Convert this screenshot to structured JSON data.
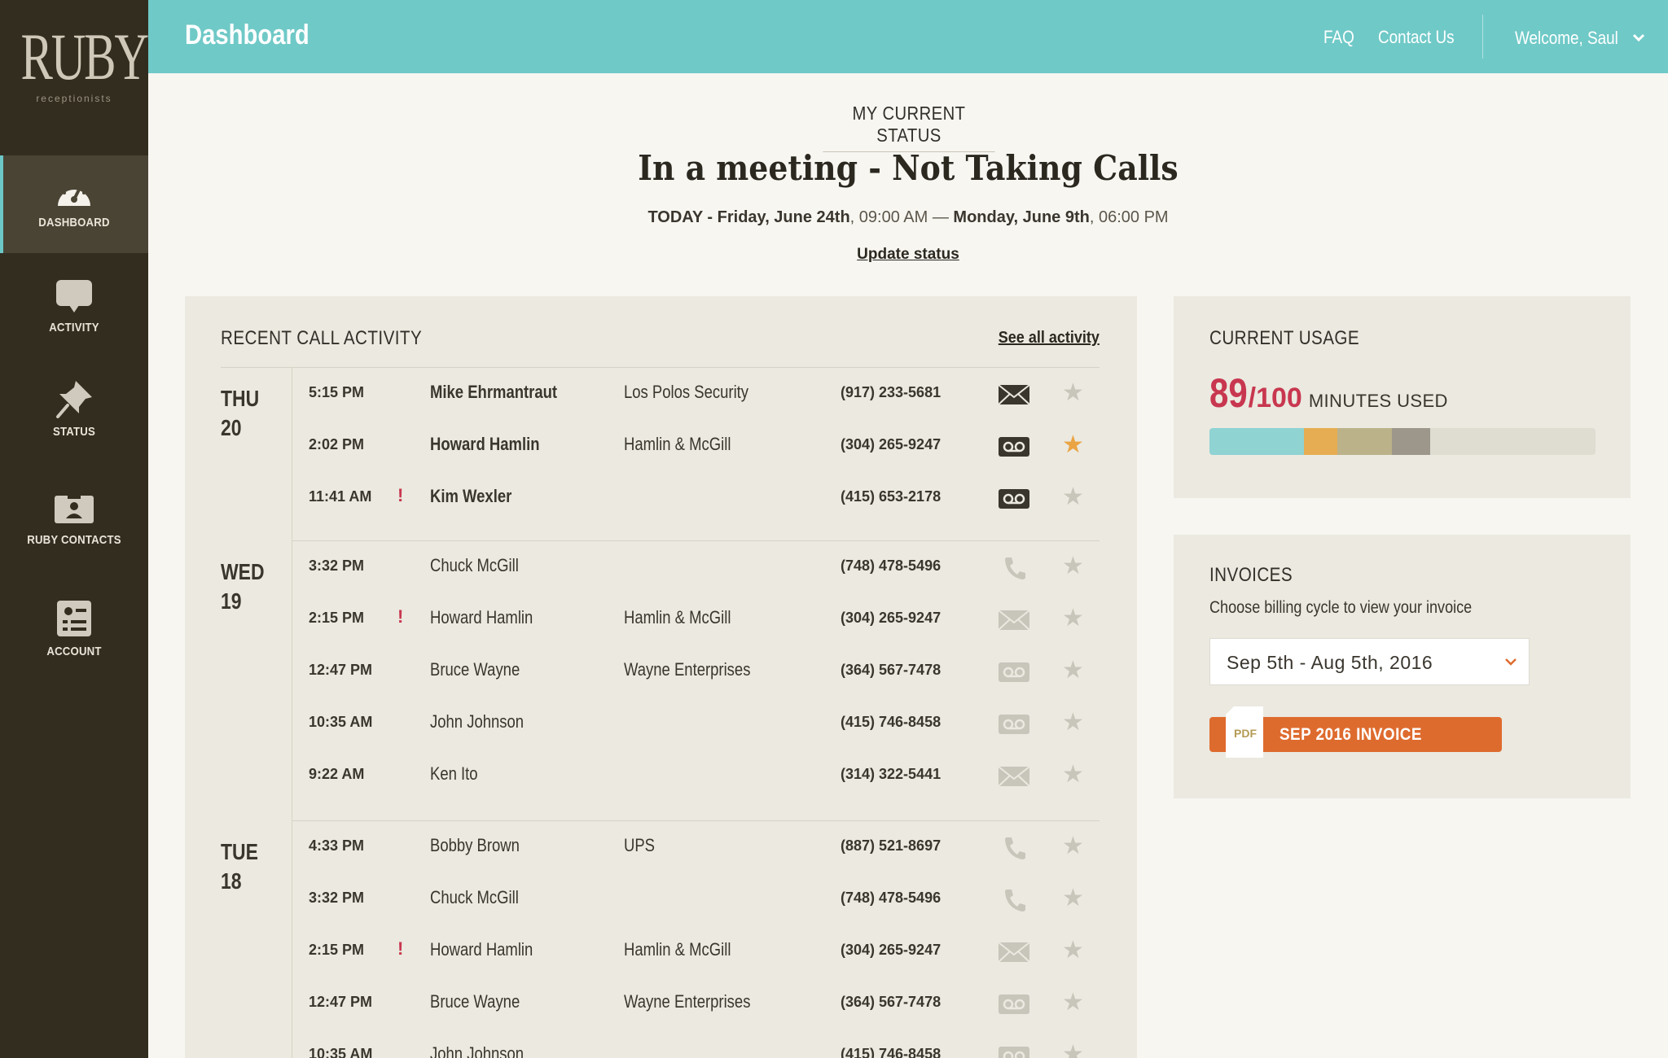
{
  "brand": {
    "logo_text": "RUBY",
    "logo_sub": "receptionists"
  },
  "nav": [
    {
      "label": "DASHBOARD",
      "icon": "speedometer-icon",
      "active": true
    },
    {
      "label": "ACTIVITY",
      "icon": "speech-bubble-icon",
      "active": false
    },
    {
      "label": "STATUS",
      "icon": "pushpin-icon",
      "active": false
    },
    {
      "label": "RUBY CONTACTS",
      "icon": "contact-card-icon",
      "active": false
    },
    {
      "label": "ACCOUNT",
      "icon": "account-book-icon",
      "active": false
    }
  ],
  "header": {
    "title": "Dashboard",
    "faq": "FAQ",
    "contact": "Contact Us",
    "welcome": "Welcome, Saul"
  },
  "status": {
    "label": "MY CURRENT STATUS",
    "text": "In a meeting - Not Taking Calls",
    "start_day": "TODAY - Friday, June 24th",
    "start_time": ", 09:00 AM",
    "sep": " — ",
    "end_day": "Monday, June 9th",
    "end_time": ", 06:00 PM",
    "update_link": "Update status"
  },
  "activity": {
    "title": "RECENT CALL ACTIVITY",
    "see_all": "See all activity",
    "days": [
      {
        "dow": "THU",
        "date": "20",
        "calls": [
          {
            "time": "5:15 PM",
            "urgent": false,
            "name": "Mike Ehrmantraut",
            "company": "Los Polos Security",
            "phone": "(917) 233-5681",
            "type": "message",
            "starred": false,
            "unread": true
          },
          {
            "time": "2:02 PM",
            "urgent": false,
            "name": "Howard Hamlin",
            "company": "Hamlin & McGill",
            "phone": "(304) 265-9247",
            "type": "voicemail",
            "starred": true,
            "unread": true
          },
          {
            "time": "11:41 AM",
            "urgent": true,
            "name": "Kim Wexler",
            "company": "",
            "phone": "(415) 653-2178",
            "type": "voicemail",
            "starred": false,
            "unread": true
          }
        ]
      },
      {
        "dow": "WED",
        "date": "19",
        "calls": [
          {
            "time": "3:32 PM",
            "urgent": false,
            "name": "Chuck McGill",
            "company": "",
            "phone": "(748) 478-5496",
            "type": "call",
            "starred": false,
            "unread": false
          },
          {
            "time": "2:15 PM",
            "urgent": true,
            "name": "Howard Hamlin",
            "company": "Hamlin & McGill",
            "phone": "(304) 265-9247",
            "type": "message",
            "starred": false,
            "unread": false
          },
          {
            "time": "12:47 PM",
            "urgent": false,
            "name": "Bruce Wayne",
            "company": "Wayne Enterprises",
            "phone": "(364) 567-7478",
            "type": "voicemail",
            "starred": false,
            "unread": false
          },
          {
            "time": "10:35 AM",
            "urgent": false,
            "name": "John Johnson",
            "company": "",
            "phone": "(415) 746-8458",
            "type": "voicemail",
            "starred": false,
            "unread": false
          },
          {
            "time": "9:22 AM",
            "urgent": false,
            "name": "Ken Ito",
            "company": "",
            "phone": "(314) 322-5441",
            "type": "message",
            "starred": false,
            "unread": false
          }
        ]
      },
      {
        "dow": "TUE",
        "date": "18",
        "calls": [
          {
            "time": "4:33 PM",
            "urgent": false,
            "name": "Bobby Brown",
            "company": "UPS",
            "phone": "(887) 521-8697",
            "type": "call",
            "starred": false,
            "unread": false
          },
          {
            "time": "3:32 PM",
            "urgent": false,
            "name": "Chuck McGill",
            "company": "",
            "phone": "(748) 478-5496",
            "type": "call",
            "starred": false,
            "unread": false
          },
          {
            "time": "2:15 PM",
            "urgent": true,
            "name": "Howard Hamlin",
            "company": "Hamlin & McGill",
            "phone": "(304) 265-9247",
            "type": "message",
            "starred": false,
            "unread": false
          },
          {
            "time": "12:47 PM",
            "urgent": false,
            "name": "Bruce Wayne",
            "company": "Wayne Enterprises",
            "phone": "(364) 567-7478",
            "type": "voicemail",
            "starred": false,
            "unread": false
          },
          {
            "time": "10:35 AM",
            "urgent": false,
            "name": "John Johnson",
            "company": "",
            "phone": "(415) 746-8458",
            "type": "voicemail",
            "starred": false,
            "unread": false
          }
        ]
      }
    ]
  },
  "usage": {
    "title": "CURRENT USAGE",
    "used": "89",
    "total": "/100",
    "label": "MINUTES USED",
    "segments": [
      {
        "fraction": 0.245,
        "color": "#8fd3d3"
      },
      {
        "fraction": 0.087,
        "color": "#e6ad52"
      },
      {
        "fraction": 0.14,
        "color": "#bbb28a"
      },
      {
        "fraction": 0.1,
        "color": "#9d978b"
      }
    ]
  },
  "invoices": {
    "title": "INVOICES",
    "help": "Choose billing cycle to view your invoice",
    "selected_cycle": "Sep 5th - Aug 5th, 2016",
    "pdf_badge": "PDF",
    "button": "SEP 2016 INVOICE"
  },
  "colors": {
    "accent": "#6fc9c7",
    "sidebar": "#332d1f",
    "alert": "#c8374f",
    "star": "#eaa443",
    "invoice_button": "#de6b2e"
  }
}
